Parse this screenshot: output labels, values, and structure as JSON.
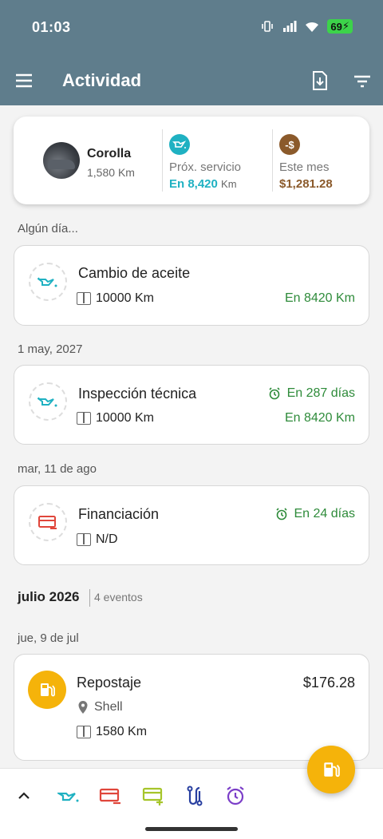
{
  "status": {
    "time": "01:03",
    "battery": "69"
  },
  "appbar": {
    "title": "Actividad"
  },
  "summary": {
    "car_name": "Corolla",
    "car_km": "1,580",
    "car_km_unit": "Km",
    "next_service_label": "Próx. servicio",
    "next_service_value": "En 8,420",
    "next_service_unit": "Km",
    "month_label": "Este mes",
    "month_value": "$1,281.28"
  },
  "sections": {
    "someday": "Algún día...",
    "may": "1 may, 2027",
    "aug": "mar, 11 de ago",
    "month_title": "julio 2026",
    "month_count": "4 eventos",
    "jul": "jue, 9 de jul"
  },
  "cards": {
    "oil": {
      "title": "Cambio de aceite",
      "km": "10000 Km",
      "due_km": "En 8420 Km"
    },
    "inspection": {
      "title": "Inspección técnica",
      "km": "10000 Km",
      "due_days": "En 287 días",
      "due_km": "En 8420 Km"
    },
    "financing": {
      "title": "Financiación",
      "km": "N/D",
      "due_days": "En 24 días"
    },
    "refuel": {
      "title": "Repostaje",
      "amount": "$176.28",
      "place": "Shell",
      "km": "1580 Km"
    }
  },
  "colors": {
    "header": "#5f7d8c",
    "teal": "#1fb1c2",
    "brown": "#8b5a2b",
    "green": "#2e8b3a",
    "red": "#e0463b",
    "amber": "#f5b30a",
    "lime": "#a6c52a",
    "indigo": "#283fa0",
    "purple": "#7b3ec8"
  },
  "icons": [
    "menu-icon",
    "download-icon",
    "filter-icon",
    "oil-can-icon",
    "dollar-icon",
    "gauge-icon",
    "alarm-icon",
    "card-icon",
    "location-icon",
    "fuel-icon",
    "chevron-up-icon",
    "card-plus-icon",
    "route-icon"
  ]
}
